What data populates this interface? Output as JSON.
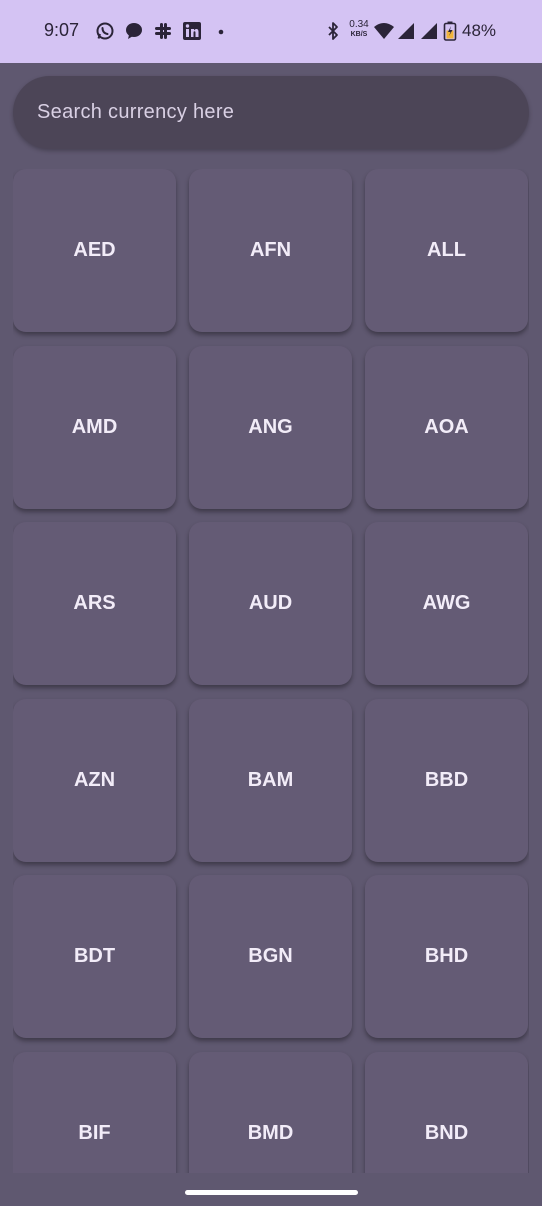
{
  "status_bar": {
    "time": "9:07",
    "net_speed_value": "0.34",
    "net_speed_unit": "KB/S",
    "battery_percent": "48%",
    "icons": [
      "whatsapp-icon",
      "chat-bubble-icon",
      "slack-icon",
      "linkedin-icon",
      "dot-icon",
      "bluetooth-icon",
      "wifi-icon",
      "signal-icon",
      "signal-icon",
      "battery-icon"
    ],
    "background_color": "#d4c3f3"
  },
  "search": {
    "placeholder": "Search currency here",
    "value": ""
  },
  "currencies": [
    "AED",
    "AFN",
    "ALL",
    "AMD",
    "ANG",
    "AOA",
    "ARS",
    "AUD",
    "AWG",
    "AZN",
    "BAM",
    "BBD",
    "BDT",
    "BGN",
    "BHD",
    "BIF",
    "BMD",
    "BND"
  ],
  "colors": {
    "background": "#5f5870",
    "card": "#645b75",
    "search_bar": "#4c4557",
    "card_text": "#f2ecf8"
  }
}
